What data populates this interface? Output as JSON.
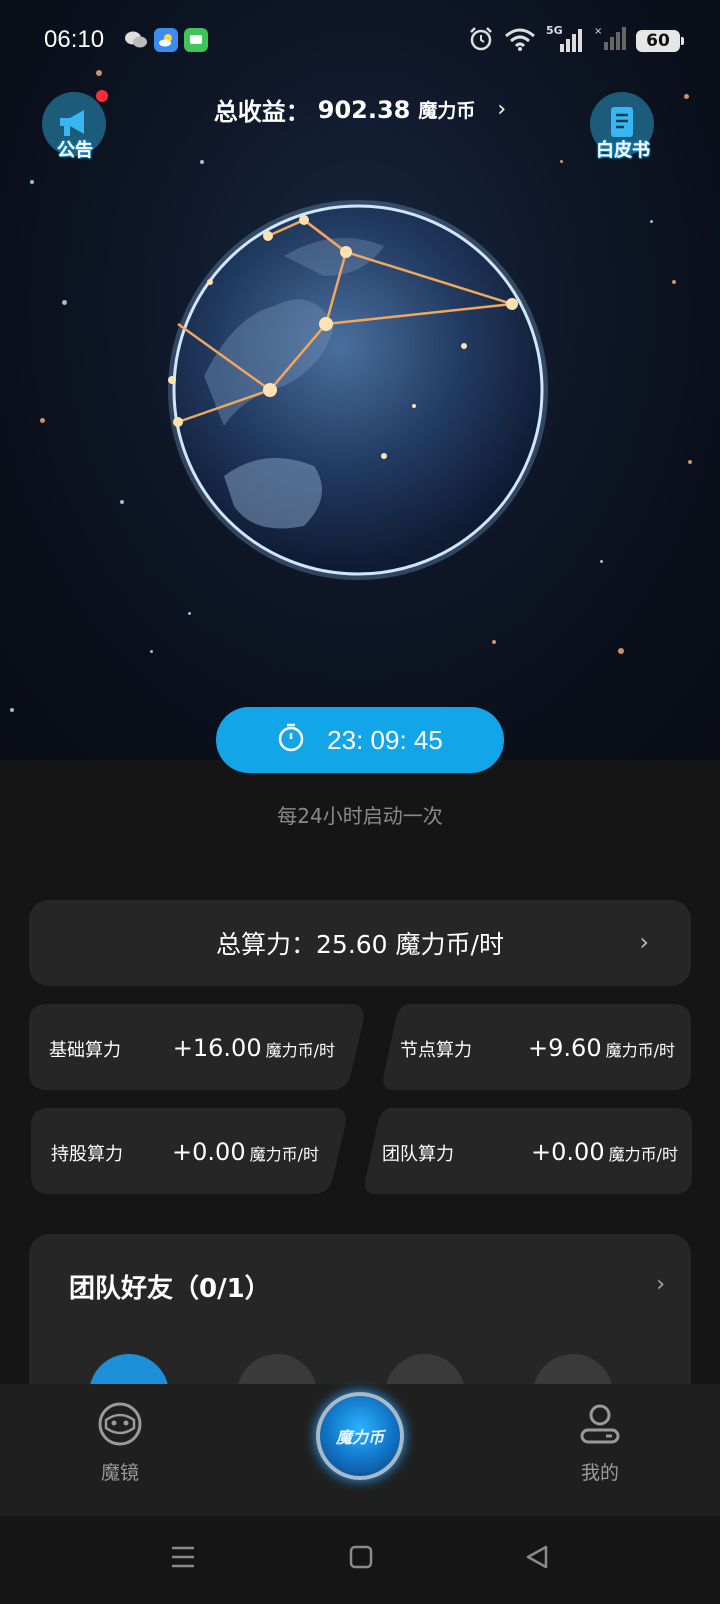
{
  "status_bar": {
    "time": "06:10",
    "network": "5G",
    "battery": "60"
  },
  "header": {
    "total_income_label": "总收益：",
    "total_income_value": "902.38",
    "total_income_unit": "魔力币",
    "announcement_label": "公告",
    "whitepaper_label": "白皮书"
  },
  "timer": {
    "countdown": "23: 09: 45",
    "hint": "每24小时启动一次"
  },
  "total_power": {
    "text": "总算力：25.60 魔力币/时"
  },
  "power_items": [
    {
      "label": "基础算力",
      "value": "+16.00",
      "unit": "魔力币/时"
    },
    {
      "label": "节点算力",
      "value": "+9.60",
      "unit": "魔力币/时"
    },
    {
      "label": "持股算力",
      "value": "+0.00",
      "unit": "魔力币/时"
    },
    {
      "label": "团队算力",
      "value": "+0.00",
      "unit": "魔力币/时"
    }
  ],
  "team": {
    "title": "团队好友（0/1）"
  },
  "bottom_nav": {
    "left_label": "魔镜",
    "center_label": "魔力币",
    "right_label": "我的"
  },
  "colors": {
    "accent": "#12a6e8",
    "card": "#262626",
    "background": "#151515"
  }
}
